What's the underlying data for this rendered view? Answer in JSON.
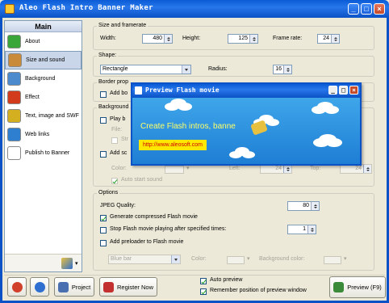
{
  "window": {
    "title": "Aleo Flash Intro Banner Maker",
    "min": "_",
    "max": "□",
    "close": "×"
  },
  "sidebar": {
    "header": "Main",
    "items": [
      {
        "label": "About",
        "icon": "home-icon",
        "color": "#3aa63a"
      },
      {
        "label": "Size and sound",
        "icon": "palette-icon",
        "color": "#c98b3a"
      },
      {
        "label": "Background",
        "icon": "picture-icon",
        "color": "#4a8acd"
      },
      {
        "label": "Effect",
        "icon": "maple-leaf-icon",
        "color": "#d23c1c"
      },
      {
        "label": "Text, image and SWF",
        "icon": "pencil-icon",
        "color": "#d4b020"
      },
      {
        "label": "Web links",
        "icon": "globe-icon",
        "color": "#2f7fd0"
      },
      {
        "label": "Publish to Banner",
        "icon": "document-icon",
        "color": "#ffffff"
      }
    ],
    "selected": 1
  },
  "size": {
    "title": "Size and framerate",
    "width_label": "Width:",
    "width": "480",
    "height_label": "Height:",
    "height": "125",
    "framerate_label": "Frame rate:",
    "framerate": "24"
  },
  "shape": {
    "title": "Shape:",
    "value": "Rectangle",
    "radius_label": "Radius:",
    "radius": "16"
  },
  "border": {
    "title": "Border prop",
    "add_label": "Add bo"
  },
  "background": {
    "title": "Background",
    "play_label": "Play b",
    "file_label": "File:",
    "stretch_label": "Str",
    "add_sound_label": "Add sc",
    "color_label": "Color:",
    "left_label": "Left:",
    "left": "24",
    "top_label": "Top:",
    "top": "24",
    "auto_label": "Auto start sound"
  },
  "options": {
    "title": "Options",
    "jpeg_label": "JPEG Quality:",
    "jpeg": "80",
    "compressed_label": "Generate compressed Flash movie",
    "stop_label": "Stop Flash movie playing after specified times:",
    "stop_times": "1",
    "preloader_label": "Add preloader to Flash movie",
    "preloader_value": "Blue bar",
    "color_label": "Color:",
    "bgcolor_label": "Background color:"
  },
  "preview": {
    "title": "Preview Flash movie",
    "banner_text": "Create Flash intros, banne",
    "url": "http://www.aleosoft.com",
    "colors": {
      "sky": "#2a8ee0",
      "text": "#ffff66",
      "url_bg": "#ffe800",
      "url_text": "#cc0000"
    }
  },
  "bottom": {
    "project_label": "Project",
    "register_label": "Register Now",
    "auto_preview_label": "Auto preview",
    "remember_label": "Remember position of preview window",
    "preview_button": "Preview (F9)"
  }
}
